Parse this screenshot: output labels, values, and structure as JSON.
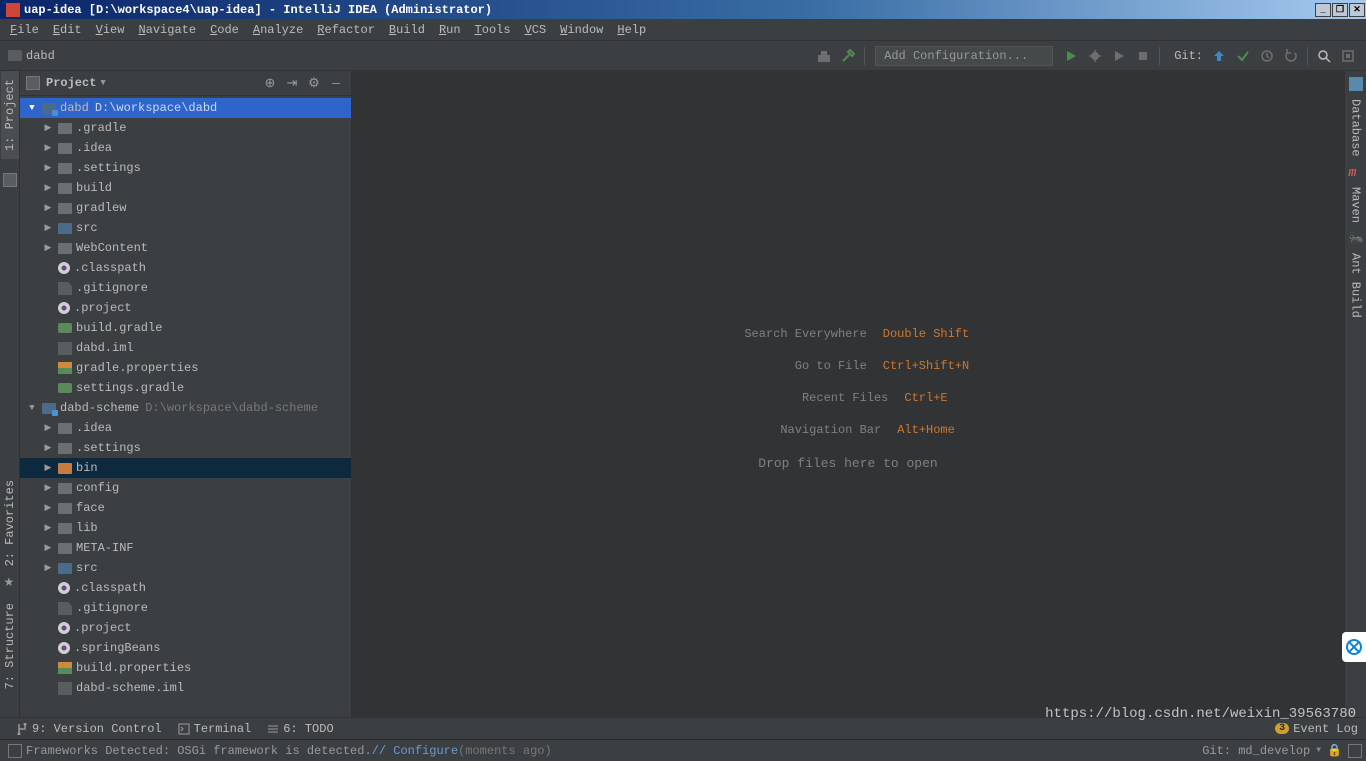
{
  "window": {
    "title": "uap-idea [D:\\workspace4\\uap-idea] - IntelliJ IDEA (Administrator)"
  },
  "menu": {
    "items": [
      "File",
      "Edit",
      "View",
      "Navigate",
      "Code",
      "Analyze",
      "Refactor",
      "Build",
      "Run",
      "Tools",
      "VCS",
      "Window",
      "Help"
    ]
  },
  "breadcrumb": {
    "project": "dabd"
  },
  "toolbar": {
    "config_placeholder": "Add Configuration...",
    "git_label": "Git:"
  },
  "left_tabs": {
    "project": "1: Project",
    "favorites": "2: Favorites",
    "structure": "7: Structure"
  },
  "right_tabs": {
    "database": "Database",
    "maven": "Maven",
    "ant": "Ant Build"
  },
  "panel": {
    "title": "Project"
  },
  "tree": {
    "root1": {
      "name": "dabd",
      "path": "D:\\workspace\\dabd"
    },
    "root1_children": [
      {
        "name": ".gradle",
        "icon": "folder",
        "indent": 1,
        "arrow": "▶"
      },
      {
        "name": ".idea",
        "icon": "folder",
        "indent": 1,
        "arrow": "▶"
      },
      {
        "name": ".settings",
        "icon": "folder",
        "indent": 1,
        "arrow": "▶"
      },
      {
        "name": "build",
        "icon": "folder",
        "indent": 1,
        "arrow": "▶"
      },
      {
        "name": "gradlew",
        "icon": "folder",
        "indent": 1,
        "arrow": "▶"
      },
      {
        "name": "src",
        "icon": "folder blue",
        "indent": 1,
        "arrow": "▶"
      },
      {
        "name": "WebContent",
        "icon": "folder",
        "indent": 1,
        "arrow": "▶"
      },
      {
        "name": ".classpath",
        "icon": "eclipse",
        "indent": 1,
        "arrow": ""
      },
      {
        "name": ".gitignore",
        "icon": "file",
        "indent": 1,
        "arrow": ""
      },
      {
        "name": ".project",
        "icon": "eclipse",
        "indent": 1,
        "arrow": ""
      },
      {
        "name": "build.gradle",
        "icon": "gradle",
        "indent": 1,
        "arrow": ""
      },
      {
        "name": "dabd.iml",
        "icon": "iml",
        "indent": 1,
        "arrow": ""
      },
      {
        "name": "gradle.properties",
        "icon": "props",
        "indent": 1,
        "arrow": ""
      },
      {
        "name": "settings.gradle",
        "icon": "gradle",
        "indent": 1,
        "arrow": ""
      }
    ],
    "root2": {
      "name": "dabd-scheme",
      "path": "D:\\workspace\\dabd-scheme"
    },
    "root2_children": [
      {
        "name": ".idea",
        "icon": "folder",
        "indent": 1,
        "arrow": "▶"
      },
      {
        "name": ".settings",
        "icon": "folder",
        "indent": 1,
        "arrow": "▶"
      },
      {
        "name": "bin",
        "icon": "folder orange",
        "indent": 1,
        "arrow": "▶",
        "selected": true
      },
      {
        "name": "config",
        "icon": "folder",
        "indent": 1,
        "arrow": "▶"
      },
      {
        "name": "face",
        "icon": "folder",
        "indent": 1,
        "arrow": "▶"
      },
      {
        "name": "lib",
        "icon": "folder",
        "indent": 1,
        "arrow": "▶"
      },
      {
        "name": "META-INF",
        "icon": "folder",
        "indent": 1,
        "arrow": "▶"
      },
      {
        "name": "src",
        "icon": "folder blue",
        "indent": 1,
        "arrow": "▶"
      },
      {
        "name": ".classpath",
        "icon": "eclipse",
        "indent": 1,
        "arrow": ""
      },
      {
        "name": ".gitignore",
        "icon": "file",
        "indent": 1,
        "arrow": ""
      },
      {
        "name": ".project",
        "icon": "eclipse",
        "indent": 1,
        "arrow": ""
      },
      {
        "name": ".springBeans",
        "icon": "eclipse",
        "indent": 1,
        "arrow": ""
      },
      {
        "name": "build.properties",
        "icon": "props",
        "indent": 1,
        "arrow": ""
      },
      {
        "name": "dabd-scheme.iml",
        "icon": "iml",
        "indent": 1,
        "arrow": ""
      }
    ]
  },
  "editor_hints": {
    "rows": [
      {
        "label": "Search Everywhere",
        "key": "Double Shift"
      },
      {
        "label": "Go to File",
        "key": "Ctrl+Shift+N"
      },
      {
        "label": "Recent Files",
        "key": "Ctrl+E"
      },
      {
        "label": "Navigation Bar",
        "key": "Alt+Home"
      }
    ],
    "drop": "Drop files here to open"
  },
  "bottom": {
    "version_control": "9: Version Control",
    "terminal": "Terminal",
    "todo": "6: TODO",
    "event_log": "Event Log",
    "event_badge": "3"
  },
  "status": {
    "message_prefix": "Frameworks Detected: OSGi framework is detected. ",
    "configure": "// Configure",
    "moments": " (moments ago)",
    "git_branch": "Git: md_develop"
  },
  "watermark": "https://blog.csdn.net/weixin_39563780"
}
